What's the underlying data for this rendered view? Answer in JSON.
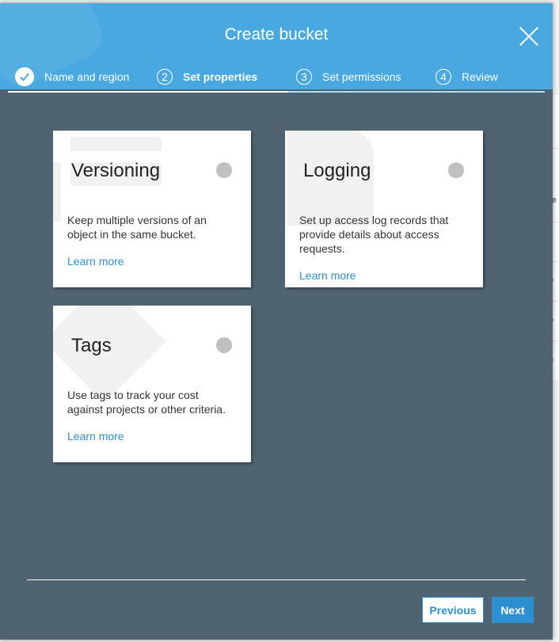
{
  "modal": {
    "title": "Create bucket",
    "close_icon": "close-icon"
  },
  "steps": [
    {
      "number": "1",
      "label": "Name and region",
      "state": "done"
    },
    {
      "number": "2",
      "label": "Set properties",
      "state": "active"
    },
    {
      "number": "3",
      "label": "Set permissions",
      "state": "pending"
    },
    {
      "number": "4",
      "label": "Review",
      "state": "pending"
    }
  ],
  "cards": [
    {
      "title": "Versioning",
      "description": "Keep multiple versions of an object in the same bucket.",
      "link": "Learn more"
    },
    {
      "title": "Logging",
      "description": "Set up access log records that provide details about access requests.",
      "link": "Learn more"
    },
    {
      "title": "Tags",
      "description": "Use tags to track your cost against projects or other criteria.",
      "link": "Learn more"
    }
  ],
  "footer": {
    "previous_label": "Previous",
    "next_label": "Next"
  },
  "background": {
    "fragments": [
      "te",
      "v",
      "o",
      "o",
      "n"
    ]
  },
  "colors": {
    "header": "#49a8e0",
    "modal_body": "#4f6470",
    "link": "#2c8fcf",
    "radio": "#c0c0c0"
  }
}
